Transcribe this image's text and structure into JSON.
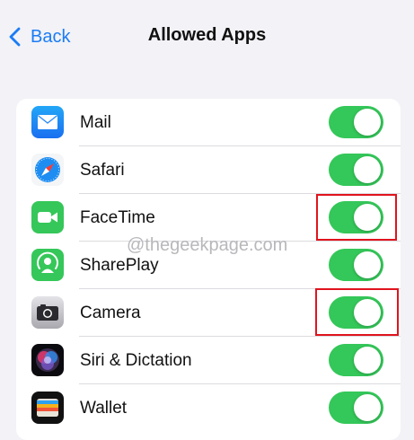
{
  "nav": {
    "back_label": "Back",
    "title": "Allowed Apps"
  },
  "watermark": "@thegeekpage.com",
  "apps": [
    {
      "label": "Mail",
      "icon": "mail-icon",
      "enabled": true,
      "highlighted": false
    },
    {
      "label": "Safari",
      "icon": "safari-icon",
      "enabled": true,
      "highlighted": false
    },
    {
      "label": "FaceTime",
      "icon": "facetime-icon",
      "enabled": true,
      "highlighted": true
    },
    {
      "label": "SharePlay",
      "icon": "shareplay-icon",
      "enabled": true,
      "highlighted": false
    },
    {
      "label": "Camera",
      "icon": "camera-icon",
      "enabled": true,
      "highlighted": true
    },
    {
      "label": "Siri & Dictation",
      "icon": "siri-icon",
      "enabled": true,
      "highlighted": false
    },
    {
      "label": "Wallet",
      "icon": "wallet-icon",
      "enabled": true,
      "highlighted": false
    }
  ],
  "colors": {
    "toggle_on": "#34c759",
    "accent": "#1b7cf5",
    "highlight": "#e0141e",
    "background": "#f2f2f7"
  }
}
